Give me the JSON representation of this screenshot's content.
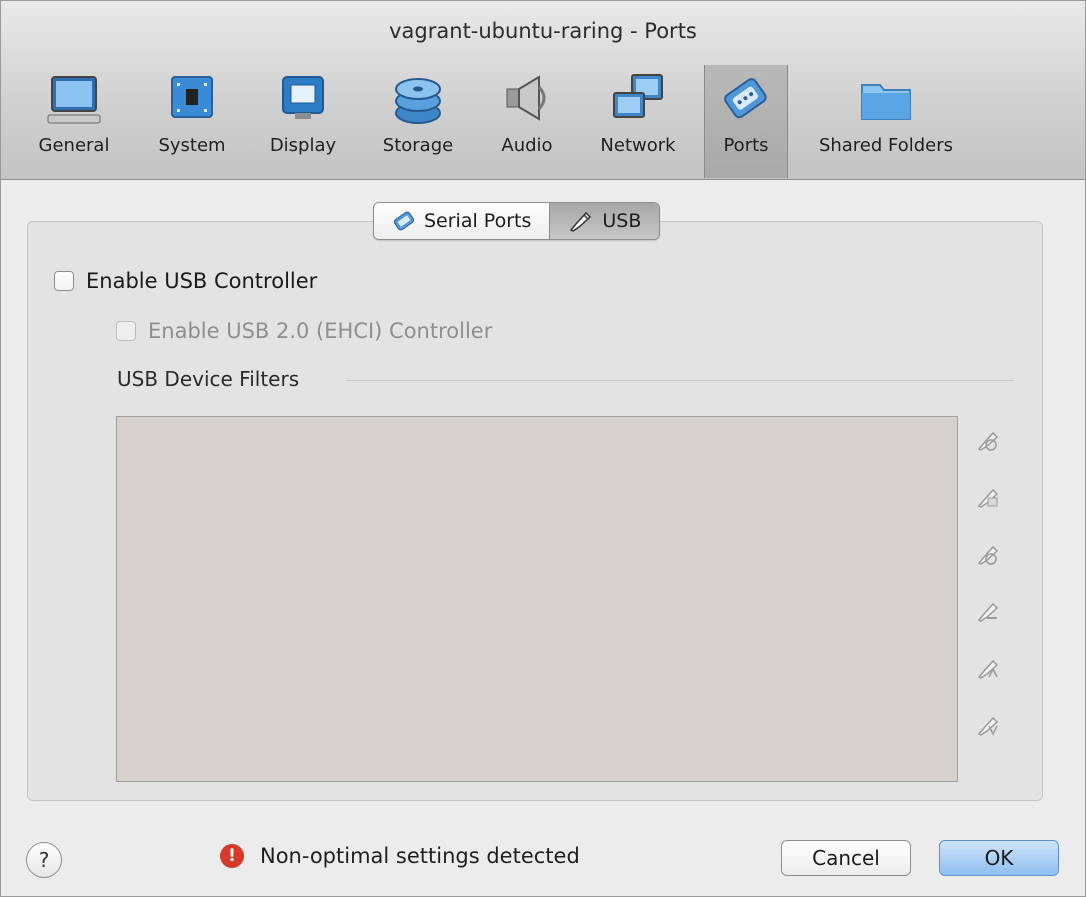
{
  "window": {
    "title": "vagrant-ubuntu-raring - Ports"
  },
  "toolbar": {
    "items": [
      {
        "label": "General",
        "icon": "monitor-icon"
      },
      {
        "label": "System",
        "icon": "chip-icon"
      },
      {
        "label": "Display",
        "icon": "display-icon"
      },
      {
        "label": "Storage",
        "icon": "disk-stack-icon"
      },
      {
        "label": "Audio",
        "icon": "speaker-icon"
      },
      {
        "label": "Network",
        "icon": "network-icon"
      },
      {
        "label": "Ports",
        "icon": "serial-port-icon",
        "selected": true
      },
      {
        "label": "Shared Folders",
        "icon": "folder-icon"
      }
    ]
  },
  "tabs": {
    "items": [
      {
        "label": "Serial Ports",
        "icon": "serial-port-icon"
      },
      {
        "label": "USB",
        "icon": "usb-pen-icon",
        "active": true
      }
    ]
  },
  "usb": {
    "enable_controller_label": "Enable USB Controller",
    "enable_controller_checked": false,
    "enable_ehci_label": "Enable USB 2.0 (EHCI) Controller",
    "enable_ehci_checked": false,
    "filters_label": "USB Device Filters",
    "filter_buttons": [
      "add-empty-filter-icon",
      "add-from-device-icon",
      "edit-filter-icon",
      "remove-filter-icon",
      "move-up-icon",
      "move-down-icon"
    ]
  },
  "footer": {
    "help_label": "?",
    "warning_text": "Non-optimal settings detected",
    "warning_icon": "!",
    "cancel_label": "Cancel",
    "ok_label": "OK"
  },
  "colors": {
    "selected_toolbar": "#a9a9a9",
    "ok_button": "#8fbef0",
    "warning": "#d63a2b",
    "filter_list_bg": "#d5d2cd"
  }
}
